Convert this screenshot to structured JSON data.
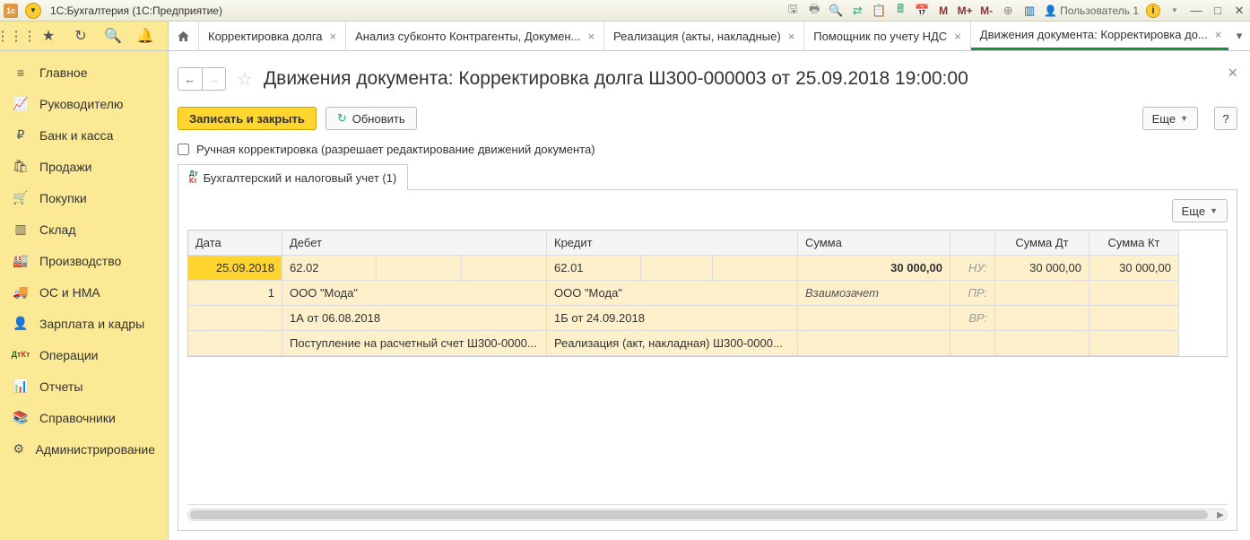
{
  "titlebar": {
    "logo_text": "1c",
    "app_title": "1С:Бухгалтерия  (1С:Предприятие)",
    "user_label": "Пользователь 1",
    "m_labels": [
      "M",
      "M+",
      "M-"
    ]
  },
  "tabs": [
    {
      "label": "Корректировка долга",
      "closable": true
    },
    {
      "label": "Анализ субконто Контрагенты, Докумен...",
      "closable": true
    },
    {
      "label": "Реализация (акты, накладные)",
      "closable": true
    },
    {
      "label": "Помощник по учету НДС",
      "closable": true
    },
    {
      "label": "Движения документа: Корректировка до...",
      "closable": true,
      "active": true
    }
  ],
  "sidebar": {
    "items": [
      {
        "icon": "menu",
        "label": "Главное"
      },
      {
        "icon": "chart",
        "label": "Руководителю"
      },
      {
        "icon": "ruble",
        "label": "Банк и касса"
      },
      {
        "icon": "bag",
        "label": "Продажи"
      },
      {
        "icon": "cart",
        "label": "Покупки"
      },
      {
        "icon": "boxes",
        "label": "Склад"
      },
      {
        "icon": "factory",
        "label": "Производство"
      },
      {
        "icon": "truck",
        "label": "ОС и НМА"
      },
      {
        "icon": "person",
        "label": "Зарплата и кадры"
      },
      {
        "icon": "dtkt",
        "label": "Операции"
      },
      {
        "icon": "report",
        "label": "Отчеты"
      },
      {
        "icon": "book",
        "label": "Справочники"
      },
      {
        "icon": "gear",
        "label": "Администрирование"
      }
    ]
  },
  "document": {
    "title": "Движения документа: Корректировка долга Ш300-000003 от 25.09.2018 19:00:00",
    "save_close": "Записать и закрыть",
    "refresh": "Обновить",
    "more": "Еще",
    "help": "?",
    "manual_checkbox": "Ручная корректировка (разрешает редактирование движений документа)",
    "register_tab": "Бухгалтерский и налоговый учет (1)"
  },
  "table": {
    "more": "Еще",
    "headers": {
      "date": "Дата",
      "debit": "Дебет",
      "credit": "Кредит",
      "sum": "Сумма",
      "sum_dt": "Сумма Дт",
      "sum_kt": "Сумма Кт"
    },
    "row1": {
      "date": "25.09.2018",
      "debit_acc": "62.02",
      "credit_acc": "62.01",
      "sum": "30 000,00",
      "label": "НУ:",
      "sum_dt": "30 000,00",
      "sum_kt": "30 000,00"
    },
    "row2": {
      "seq": "1",
      "debit_subc": "ООО \"Мода\"",
      "credit_subc": "ООО \"Мода\"",
      "note": "Взаимозачет",
      "label": "ПР:"
    },
    "row3": {
      "debit_doc": "1А от 06.08.2018",
      "credit_doc": "1Б от 24.09.2018",
      "label": "ВР:"
    },
    "row4": {
      "debit_detail": "Поступление на расчетный счет Ш300-0000...",
      "credit_detail": "Реализация (акт, накладная) Ш300-0000..."
    }
  }
}
